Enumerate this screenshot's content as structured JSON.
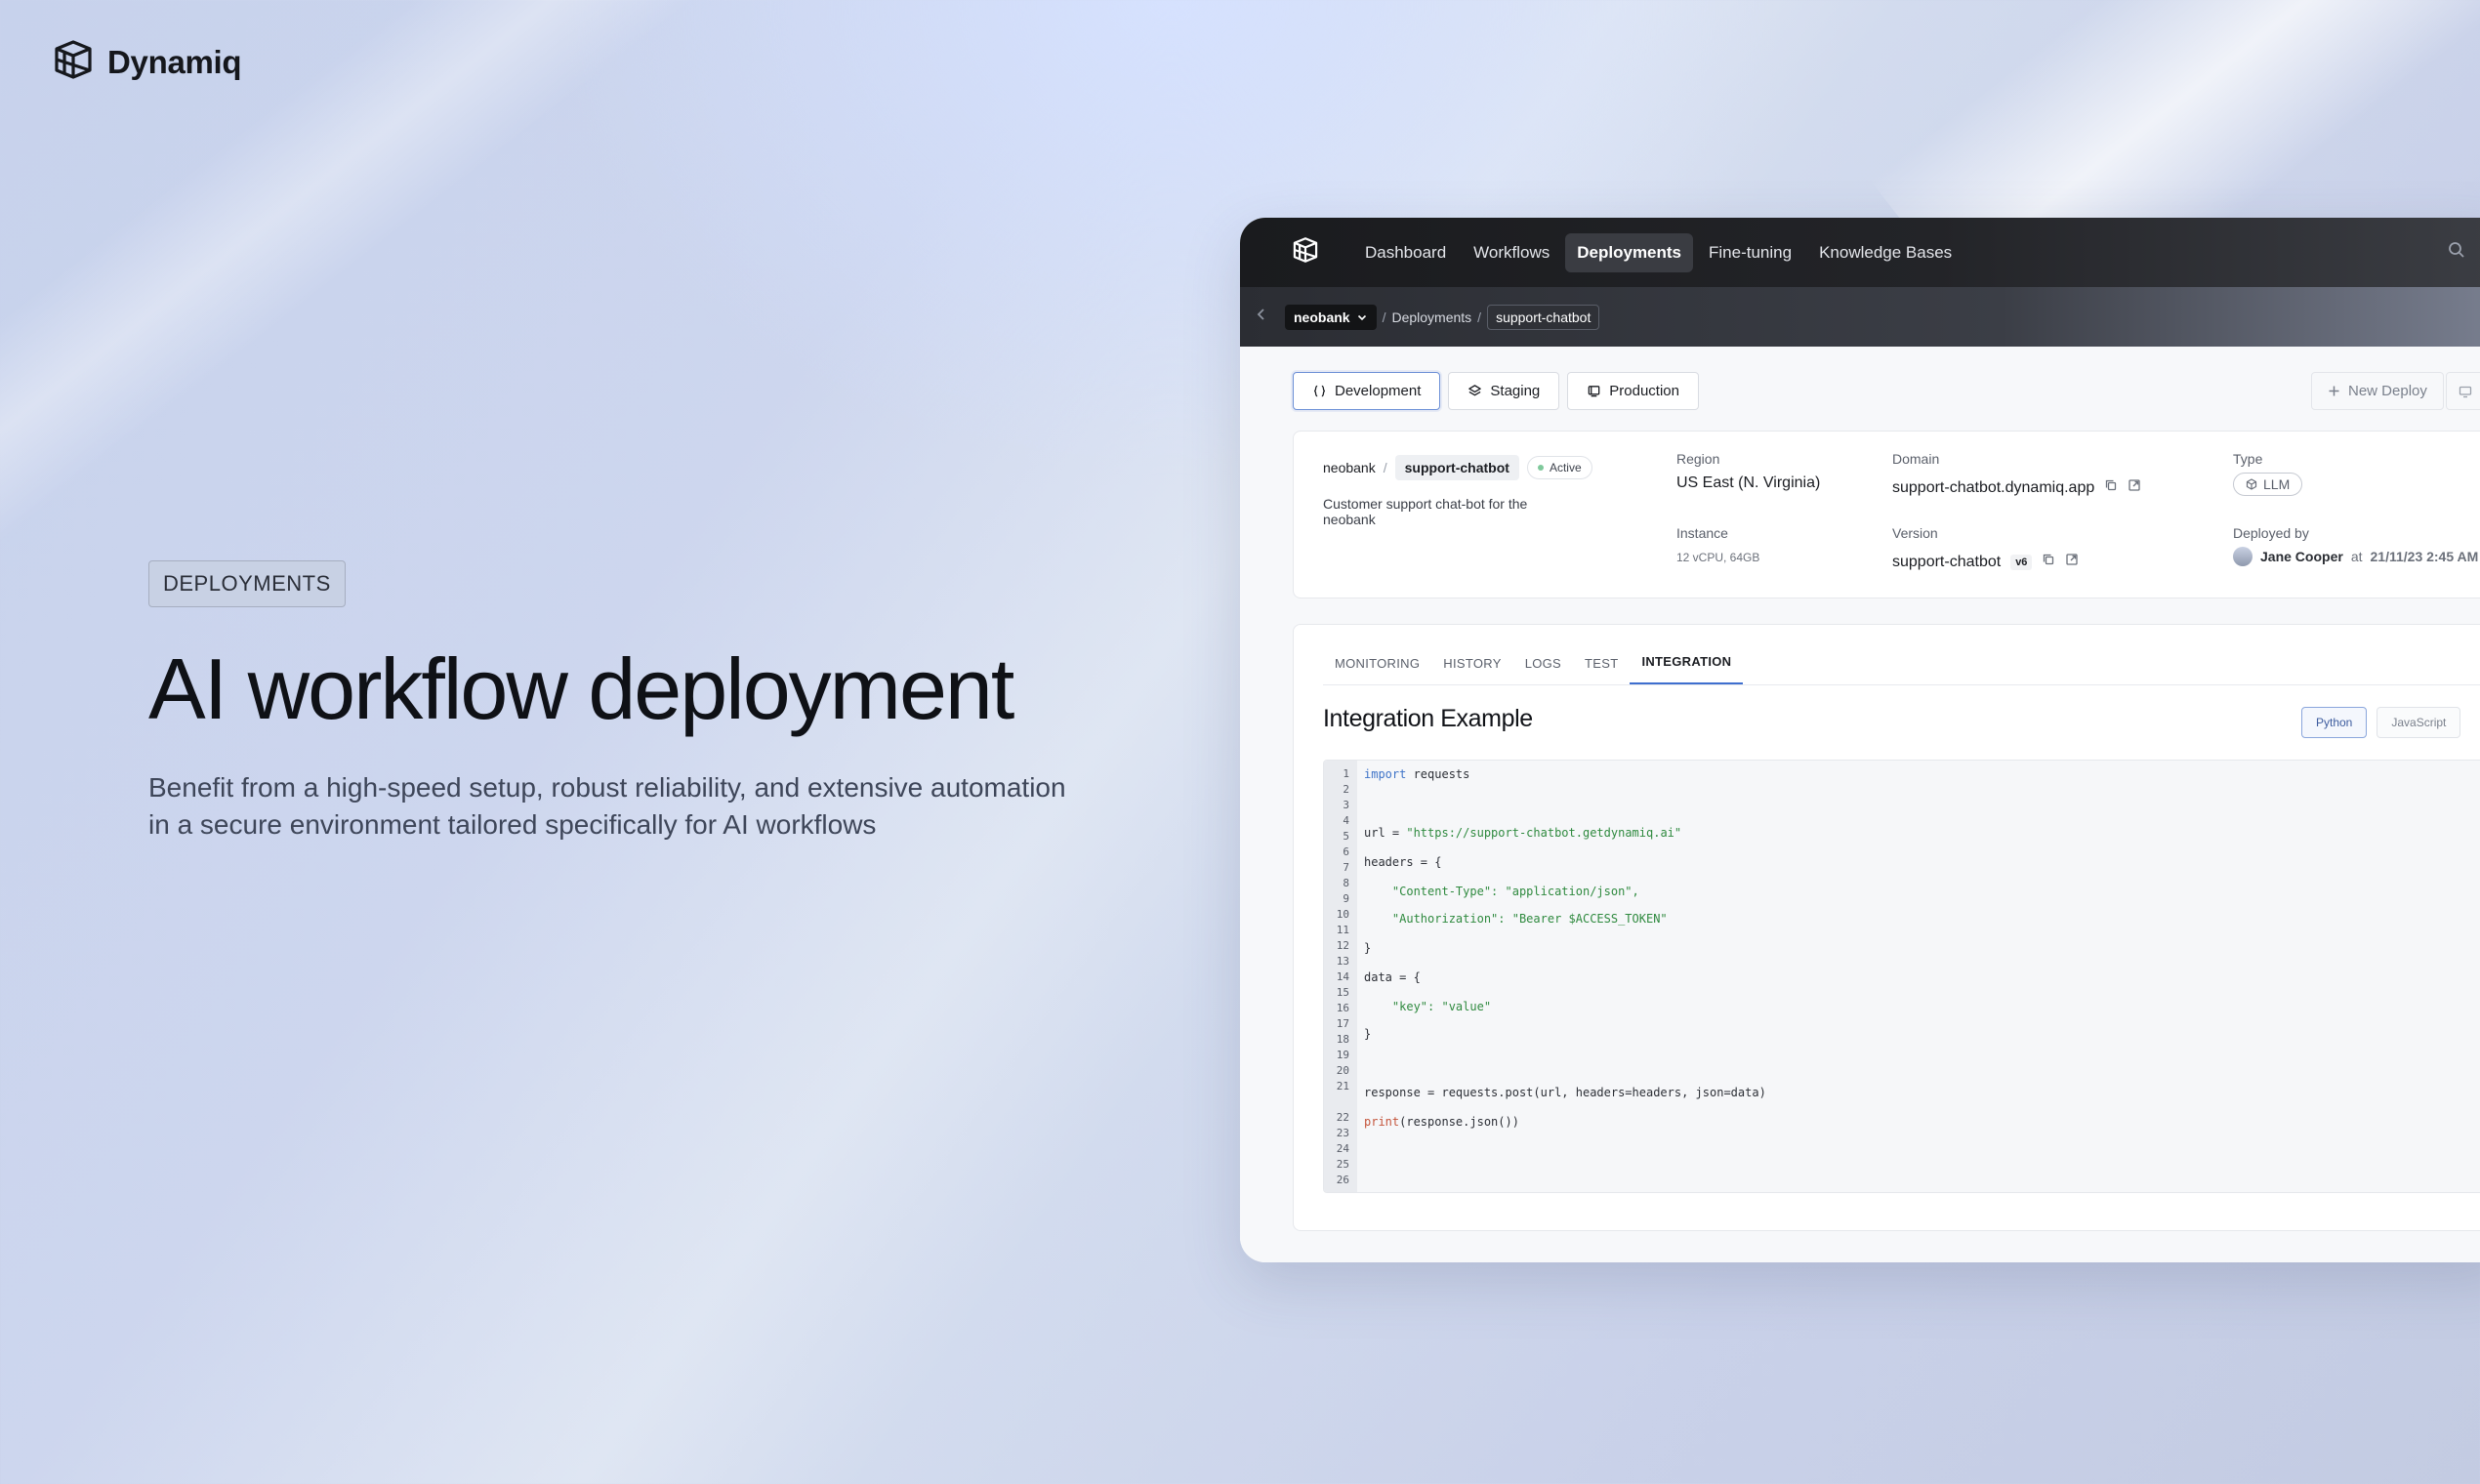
{
  "brand": {
    "name": "Dynamiq"
  },
  "hero": {
    "eyebrow": "DEPLOYMENTS",
    "title": "AI workflow deployment",
    "subtitle": "Benefit from a high-speed setup, robust reliability, and extensive automation in a secure environment tailored specifically for AI workflows"
  },
  "app": {
    "nav": {
      "items": [
        {
          "label": "Dashboard"
        },
        {
          "label": "Workflows"
        },
        {
          "label": "Deployments"
        },
        {
          "label": "Fine-tuning"
        },
        {
          "label": "Knowledge Bases"
        }
      ],
      "active": "Deployments"
    },
    "breadcrumb": {
      "org": "neobank",
      "section": "Deployments",
      "current": "support-chatbot"
    },
    "environments": [
      {
        "label": "Development",
        "icon": "braces-icon"
      },
      {
        "label": "Staging",
        "icon": "layers-icon"
      },
      {
        "label": "Production",
        "icon": "server-icon"
      }
    ],
    "active_environment": "Development",
    "new_deploy_label": "New Deploy",
    "deployment": {
      "org": "neobank",
      "name": "support-chatbot",
      "status": "Active",
      "description": "Customer support chat-bot for the neobank",
      "region_label": "Region",
      "region": "US East (N. Virginia)",
      "instance_label": "Instance",
      "instance": "12 vCPU, 64GB",
      "domain_label": "Domain",
      "domain": "support-chatbot.dynamiq.app",
      "version_label": "Version",
      "version_name": "support-chatbot",
      "version_badge": "v6",
      "type_label": "Type",
      "type": "LLM",
      "deployed_by_label": "Deployed by",
      "deployed_by": "Jane Cooper",
      "deployed_at_word": "at",
      "deployed_at": "21/11/23 2:45 AM"
    },
    "tabs": [
      {
        "label": "MONITORING"
      },
      {
        "label": "HISTORY"
      },
      {
        "label": "LOGS"
      },
      {
        "label": "TEST"
      },
      {
        "label": "INTEGRATION"
      }
    ],
    "active_tab": "INTEGRATION",
    "integration": {
      "title": "Integration Example",
      "languages": [
        {
          "label": "Python"
        },
        {
          "label": "JavaScript"
        }
      ],
      "active_language": "Python",
      "line_numbers": [
        "1",
        "2",
        "3",
        "4",
        "5",
        "6",
        "7",
        "8",
        "9",
        "10",
        "11",
        "12",
        "13",
        "14",
        "15",
        "16",
        "17",
        "18",
        "19",
        "20",
        "21",
        "22",
        "23",
        "24",
        "25",
        "26"
      ],
      "code": {
        "l1_kw": "import",
        "l1_rest": " requests",
        "l2_a": "url = ",
        "l2_str": "\"https://support-chatbot.getdynamiq.ai\"",
        "l3": "headers = {",
        "l4_str": "    \"Content-Type\": \"application/json\",",
        "l5_str": "    \"Authorization\": \"Bearer $ACCESS_TOKEN\"",
        "l6": "}",
        "l7": "data = {",
        "l8_str": "    \"key\": \"value\"",
        "l9": "}",
        "l10": "response = requests.post(url, headers=headers, json=data)",
        "l11_fn": "print",
        "l11_rest": "(response.json())"
      }
    }
  }
}
